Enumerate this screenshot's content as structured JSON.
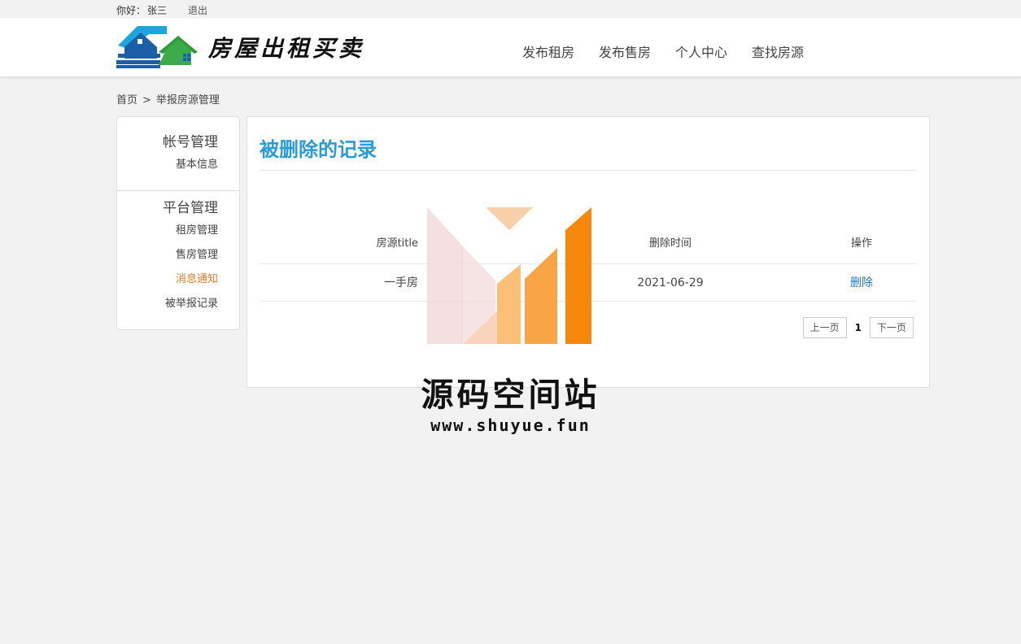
{
  "topbar": {
    "greeting": "你好：",
    "username": "张三",
    "logout": "退出"
  },
  "header": {
    "logo_text": "房屋出租买卖",
    "logo_icon": "house-logo-icon",
    "nav": [
      {
        "label": "发布租房"
      },
      {
        "label": "发布售房"
      },
      {
        "label": "个人中心"
      },
      {
        "label": "查找房源"
      }
    ]
  },
  "breadcrumb": {
    "home": "首页",
    "separator": ">",
    "current": "举报房源管理"
  },
  "sidebar": {
    "groups": [
      {
        "title": "帐号管理",
        "items": [
          {
            "label": "基本信息"
          }
        ]
      },
      {
        "title": "平台管理",
        "items": [
          {
            "label": "租房管理"
          },
          {
            "label": "售房管理"
          },
          {
            "label": "消息通知",
            "active": true
          },
          {
            "label": "被举报记录"
          }
        ]
      }
    ],
    "active_color": "#e87a2b"
  },
  "main": {
    "title": "被删除的记录",
    "title_color": "#2a9bd6",
    "table": {
      "headers": [
        "房源title",
        "删除时间",
        "操作"
      ],
      "rows": [
        {
          "title": "一手房",
          "deleted_at": "2021-06-29",
          "action": "删除"
        }
      ]
    },
    "pager": {
      "prev": "上一页",
      "current": "1",
      "next": "下一页"
    }
  },
  "watermark": {
    "name": "源码空间站",
    "url": "www.shuyue.fun"
  }
}
